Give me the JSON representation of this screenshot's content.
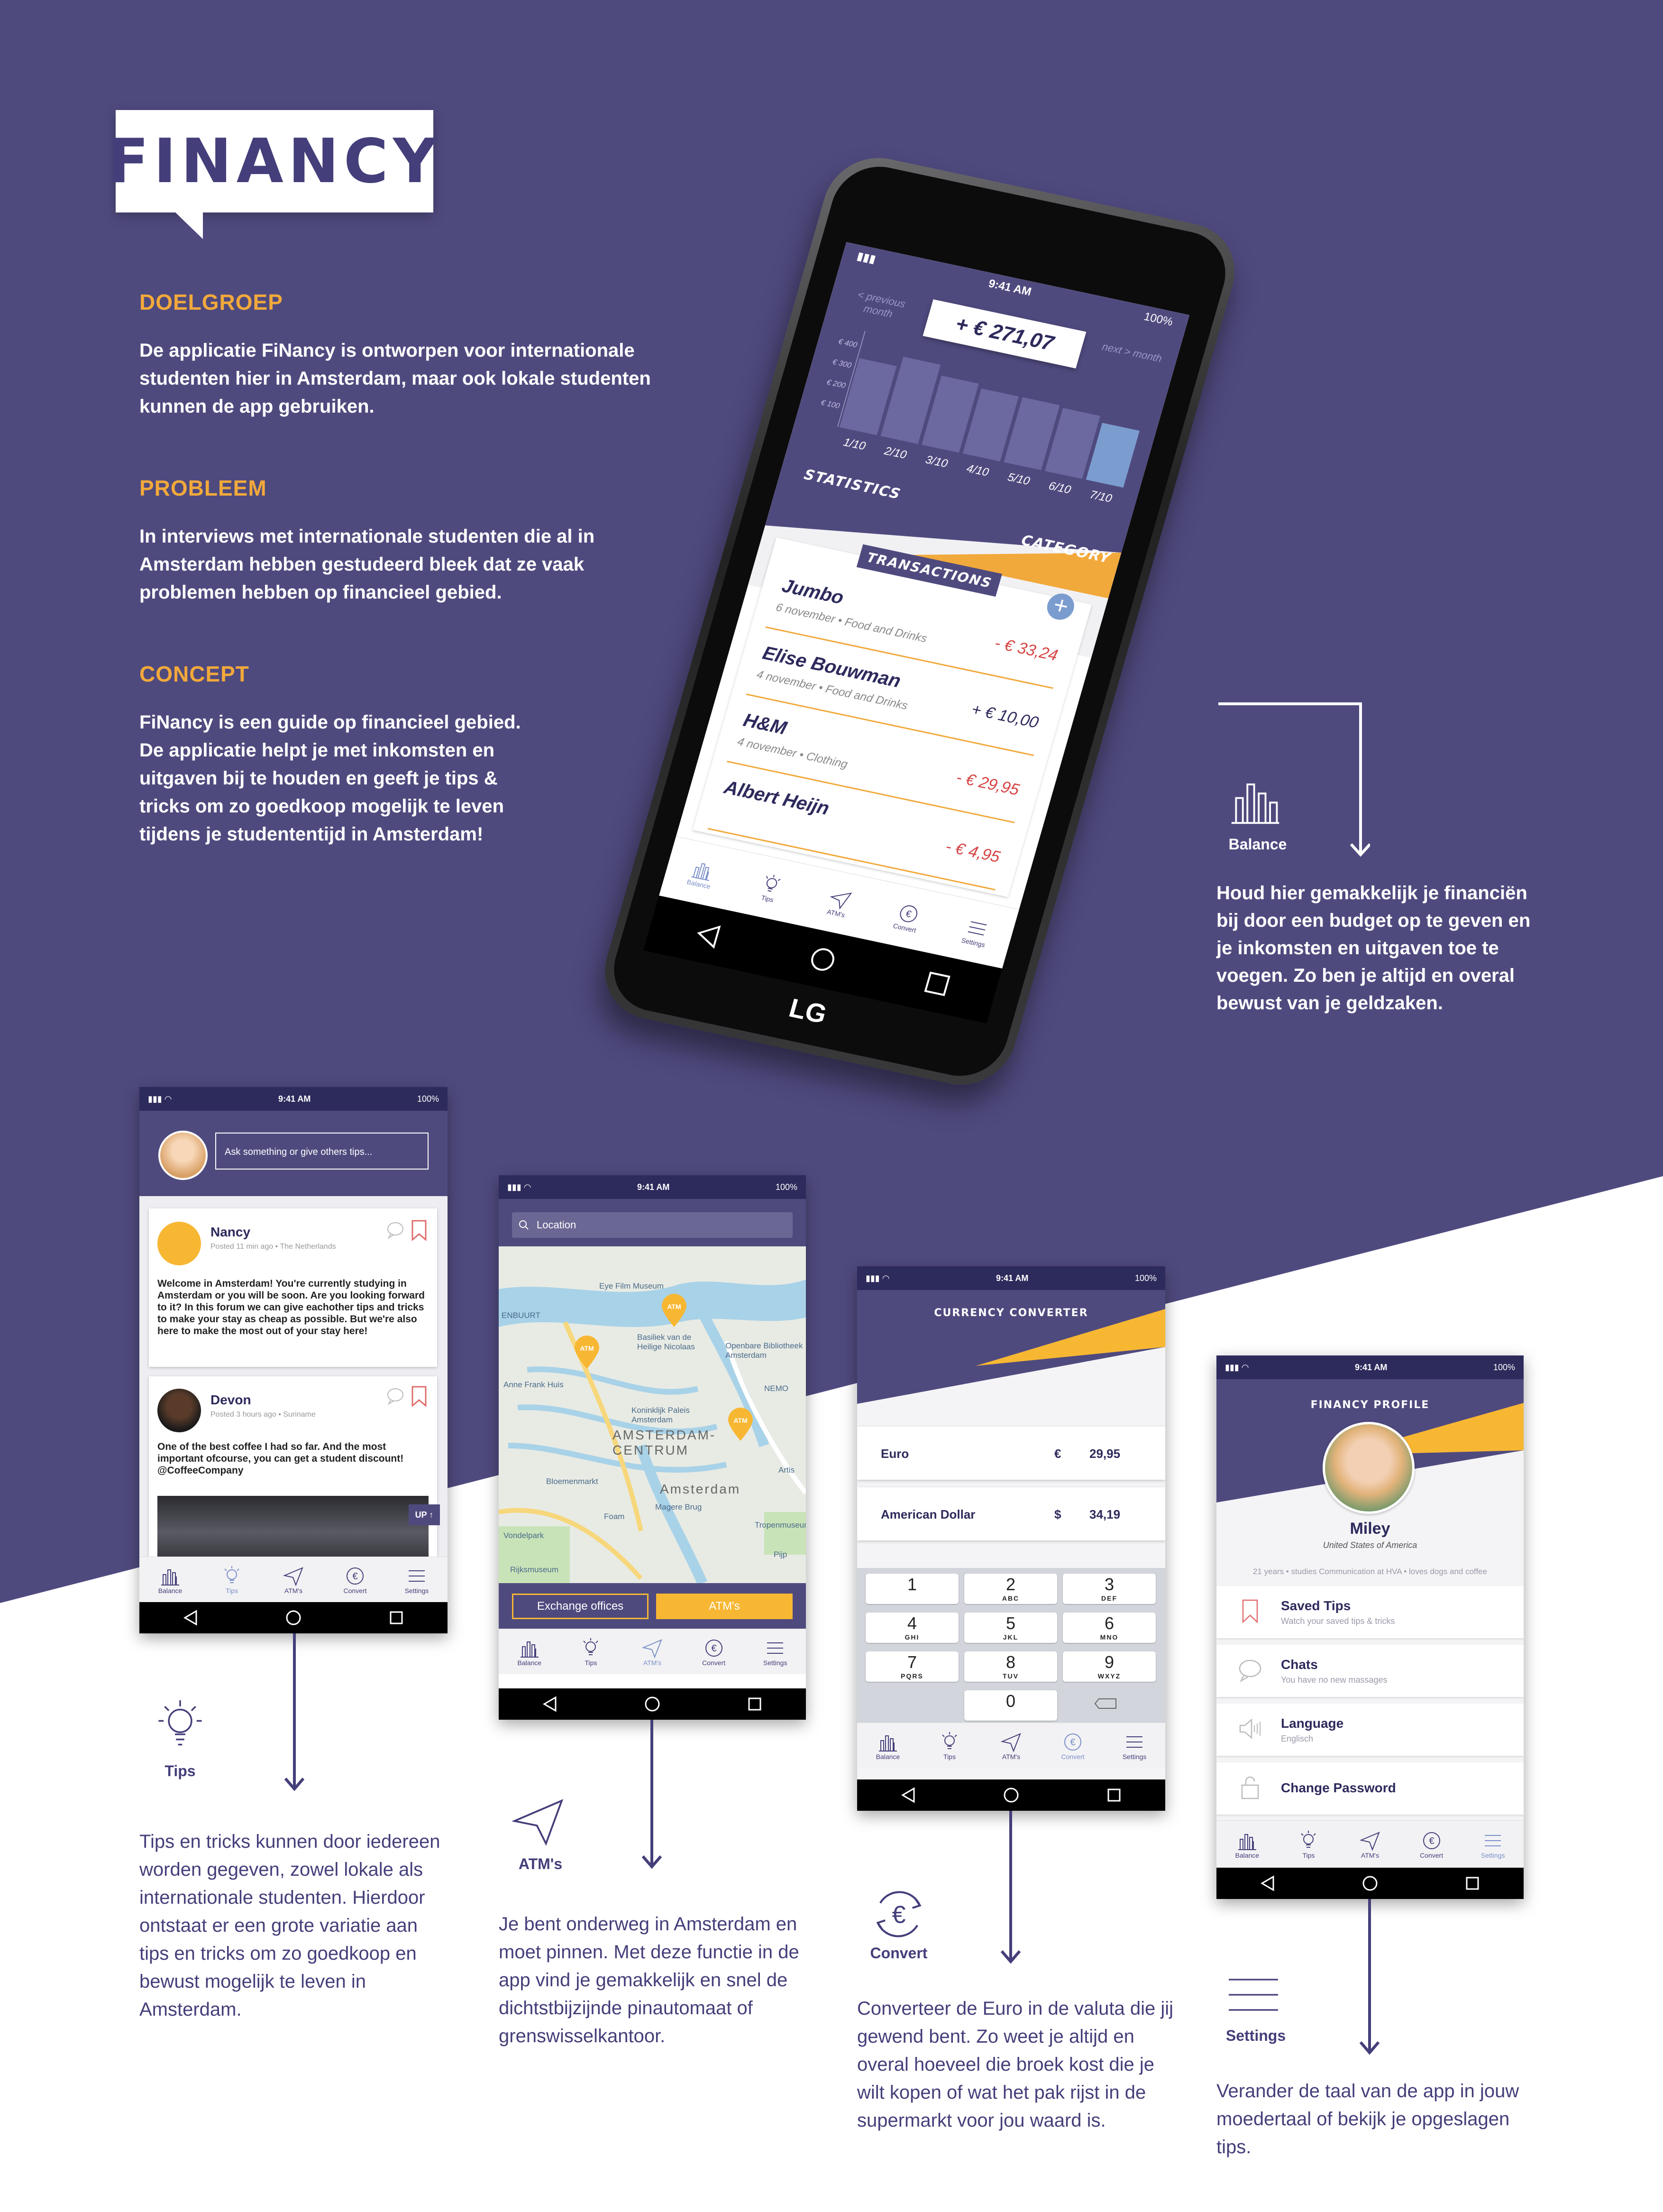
{
  "colors": {
    "purple": "#4f4a7e",
    "dark_purple": "#2d2a5c",
    "orange": "#f2a93b",
    "white": "#ffffff",
    "red": "#d64545",
    "blue_bar": "#7b9ccf"
  },
  "logo": {
    "text": "FINANCY"
  },
  "intro": {
    "sections": [
      {
        "heading": "DOELGROEP",
        "body": "De applicatie FiNancy is ontworpen voor internationale studenten hier in Amsterdam, maar ook lokale studenten kunnen de app gebruiken."
      },
      {
        "heading": "PROBLEEM",
        "body": "In interviews met internationale studenten die al in Amsterdam hebben gestudeerd bleek dat ze vaak problemen hebben op financieel gebied."
      },
      {
        "heading": "CONCEPT",
        "body": "FiNancy is een guide op financieel gebied. De applicatie helpt je met inkomsten en uitgaven bij te houden en geeft je tips & tricks om zo goedkoop mogelijk te leven tijdens je studententijd in Amsterdam!"
      }
    ]
  },
  "balance_phone": {
    "brand": "LG",
    "status": {
      "time": "9:41 AM",
      "battery": "100%"
    },
    "prev_month": "< previous month",
    "next_month": "next > month",
    "balance": "+ € 271,07",
    "tab_statistics": "STATISTICS",
    "tab_category": "CATEGORY",
    "transactions_title": "TRANSACTIONS",
    "transactions": [
      {
        "name": "Jumbo",
        "meta": "6 november • Food and Drinks",
        "amount": "- € 33,24",
        "type": "neg"
      },
      {
        "name": "Elise Bouwman",
        "meta": "4 november • Food and Drinks",
        "amount": "+ € 10,00",
        "type": "pos"
      },
      {
        "name": "H&M",
        "meta": "4 november • Clothing",
        "amount": "- € 29,95",
        "type": "neg"
      },
      {
        "name": "Albert Heijn",
        "meta": "",
        "amount": "- € 4,95",
        "type": "neg"
      }
    ],
    "nav": [
      "Balance",
      "Tips",
      "ATM's",
      "Convert",
      "Settings"
    ]
  },
  "chart_data": {
    "type": "bar",
    "categories": [
      "1/10",
      "2/10",
      "3/10",
      "4/10",
      "5/10",
      "6/10",
      "7/10"
    ],
    "values": [
      340,
      390,
      340,
      320,
      320,
      310,
      280
    ],
    "ylim": [
      0,
      450
    ],
    "yticks": [
      "€ 100",
      "€ 200",
      "€ 300",
      "€ 400"
    ],
    "highlight_index": 6
  },
  "balance_feature": {
    "label": "Balance",
    "text": "Houd hier gemakkelijk je financiën bij door een budget op te geven en je inkomsten en uitgaven toe te voegen. Zo ben je altijd en overal bewust van je geldzaken."
  },
  "tips_screen": {
    "status": {
      "time": "9:41 AM",
      "battery": "100%"
    },
    "ask_placeholder": "Ask something or give others tips...",
    "posts": [
      {
        "name": "Nancy",
        "meta": "Posted 11 min ago • The Netherlands",
        "text": "Welcome in Amsterdam! You're currently studying in Amsterdam or you will be soon. Are you looking forward to it? In this forum we can give eachother tips and tricks to make your stay as cheap as possible. But we're also here to make the most out of your stay here!"
      },
      {
        "name": "Devon",
        "meta": "Posted 3 hours ago • Suriname",
        "text": "One of the best coffee I had so far. And the most important ofcourse, you can get a student discount! @CoffeeCompany"
      }
    ],
    "up_button": "UP ↑",
    "nav": [
      "Balance",
      "Tips",
      "ATM's",
      "Convert",
      "Settings"
    ]
  },
  "tips_feature": {
    "label": "Tips",
    "text": "Tips en tricks kunnen door iedereen worden gegeven, zowel lokale als internationale studenten. Hierdoor ontstaat er een grote variatie aan tips en tricks om zo goedkoop en bewust mogelijk te leven in Amsterdam."
  },
  "atm_screen": {
    "status": {
      "time": "9:41 AM",
      "battery": "100%"
    },
    "search_placeholder": "Location",
    "map_labels": [
      "Eye Film Museum",
      "ENBUURT",
      "Basiliek van de Heilige Nicolaas",
      "Openbare Bibliotheek Amsterdam",
      "Anne Frank Huis",
      "Koninklijk Paleis Amsterdam",
      "AMSTERDAM-CENTRUM",
      "NEMO",
      "Bloemenmarkt",
      "Amsterdam",
      "Magere Brug",
      "Foam",
      "Tropenmuseum",
      "Artis",
      "Vondelpark",
      "Rijksmuseum",
      "Pijp"
    ],
    "pin_label": "ATM",
    "btn_exchange": "Exchange offices",
    "btn_atms": "ATM's",
    "nav": [
      "Balance",
      "Tips",
      "ATM's",
      "Convert",
      "Settings"
    ]
  },
  "atm_feature": {
    "label": "ATM's",
    "text": "Je bent onderweg in Amsterdam en moet pinnen. Met deze functie in de app vind je gemakkelijk en snel de dichtstbijzijnde pinautomaat of grenswisselkantoor."
  },
  "convert_screen": {
    "status": {
      "time": "9:41 AM",
      "battery": "100%"
    },
    "title": "CURRENCY CONVERTER",
    "rows": [
      {
        "currency": "Euro",
        "symbol": "€",
        "value": "29,95"
      },
      {
        "currency": "American Dollar",
        "symbol": "$",
        "value": "34,19"
      }
    ],
    "keys": [
      {
        "n": "1",
        "l": ""
      },
      {
        "n": "2",
        "l": "ABC"
      },
      {
        "n": "3",
        "l": "DEF"
      },
      {
        "n": "4",
        "l": "GHI"
      },
      {
        "n": "5",
        "l": "JKL"
      },
      {
        "n": "6",
        "l": "MNO"
      },
      {
        "n": "7",
        "l": "PQRS"
      },
      {
        "n": "8",
        "l": "TUV"
      },
      {
        "n": "9",
        "l": "WXYZ"
      },
      {
        "n": "0",
        "l": ""
      }
    ],
    "nav": [
      "Balance",
      "Tips",
      "ATM's",
      "Convert",
      "Settings"
    ]
  },
  "convert_feature": {
    "label": "Convert",
    "text": "Converteer de Euro in de valuta die jij gewend bent. Zo weet je altijd en overal hoeveel die broek kost die je wilt kopen of wat het pak rijst in de supermarkt voor jou waard is."
  },
  "settings_screen": {
    "status": {
      "time": "9:41 AM",
      "battery": "100%"
    },
    "title": "FINANCY PROFILE",
    "name": "Miley",
    "country": "United States of America",
    "bio": "21 years • studies Communication at HVA • loves dogs and coffee",
    "items": [
      {
        "title": "Saved Tips",
        "sub": "Watch your saved tips & tricks"
      },
      {
        "title": "Chats",
        "sub": "You have no new massages"
      },
      {
        "title": "Language",
        "sub": "Englisch"
      },
      {
        "title": "Change Password",
        "sub": ""
      }
    ],
    "nav": [
      "Balance",
      "Tips",
      "ATM's",
      "Convert",
      "Settings"
    ]
  },
  "settings_feature": {
    "label": "Settings",
    "text": "Verander de taal van de app in jouw moedertaal of bekijk je opgeslagen tips."
  }
}
